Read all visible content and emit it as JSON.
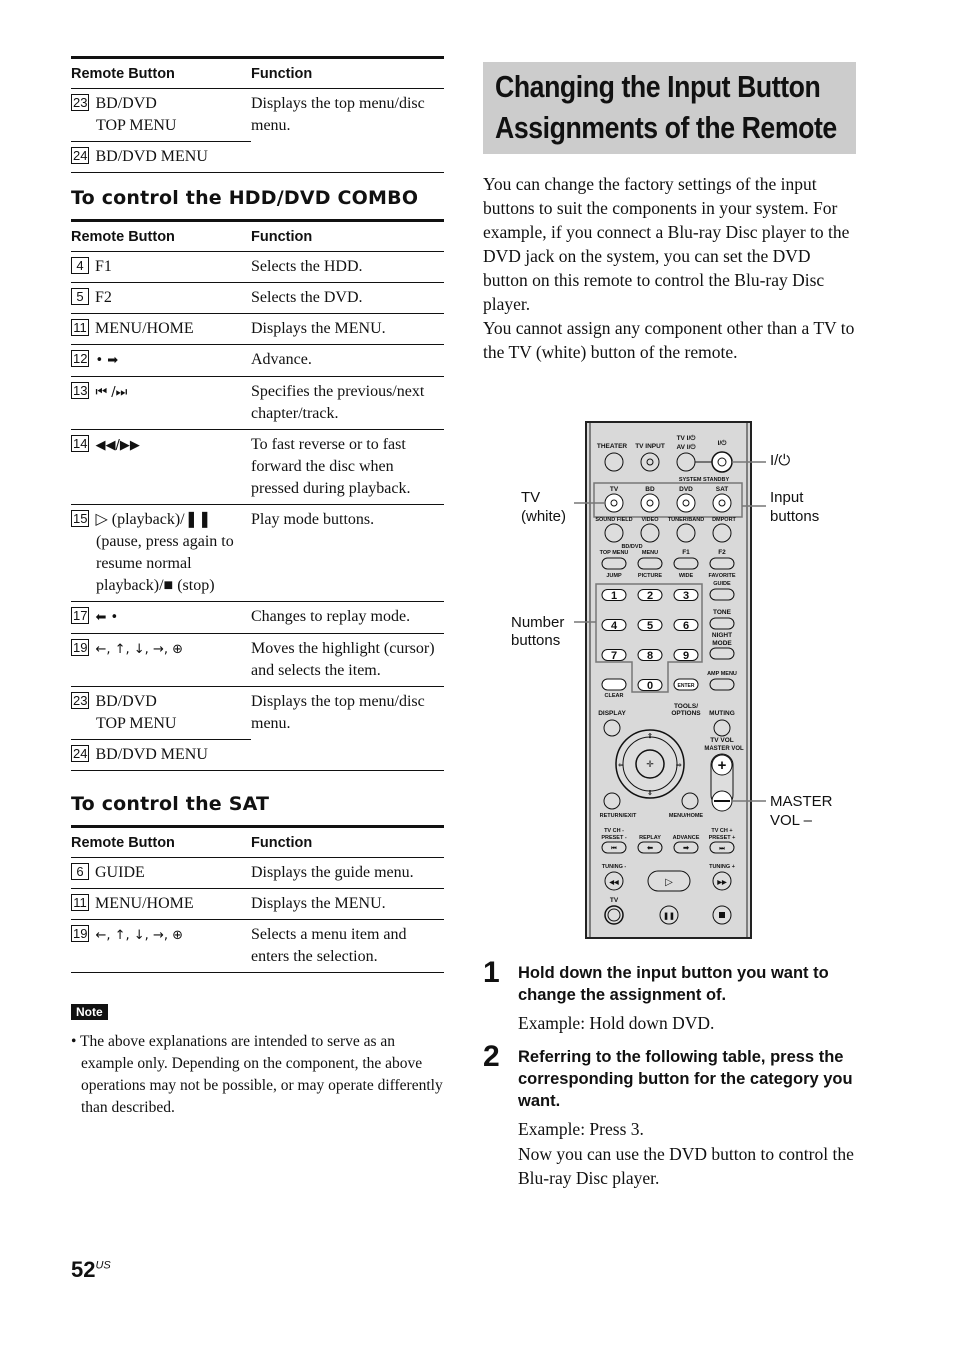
{
  "tables": {
    "continued": {
      "headers": [
        "Remote Button",
        "Function"
      ],
      "rows": [
        {
          "num": "23",
          "button": "BD/DVD",
          "button2": "TOP MENU",
          "function": "Displays the top menu/disc menu."
        },
        {
          "num": "24",
          "button": "BD/DVD MENU",
          "function": ""
        }
      ]
    },
    "hdd": {
      "heading": "To control the HDD/DVD COMBO",
      "headers": [
        "Remote Button",
        "Function"
      ],
      "rows": [
        {
          "num": "4",
          "button": "F1",
          "function": "Selects the HDD."
        },
        {
          "num": "5",
          "button": "F2",
          "function": "Selects the DVD."
        },
        {
          "num": "11",
          "button": "MENU/HOME",
          "function": "Displays the MENU."
        },
        {
          "num": "12",
          "button": "• ➡",
          "function": "Advance."
        },
        {
          "num": "13",
          "button": "⏮ /⏭",
          "function": "Specifies the previous/next chapter/track."
        },
        {
          "num": "14",
          "button": "◀◀/▶▶",
          "function": "To fast reverse or to fast forward the disc when pressed during playback."
        },
        {
          "num": "15",
          "button": "▷ (playback)/❚❚",
          "button2": "(pause, press again to resume normal playback)/■ (stop)",
          "function": "Play mode buttons."
        },
        {
          "num": "17",
          "button": "⬅ •",
          "function": "Changes to replay mode."
        },
        {
          "num": "19",
          "button": "←, ↑, ↓, →, ⊕",
          "function": "Moves the highlight (cursor) and selects the item."
        },
        {
          "num": "23",
          "button": "BD/DVD",
          "button2": "TOP MENU",
          "function": "Displays the top menu/disc menu."
        },
        {
          "num": "24",
          "button": "BD/DVD MENU",
          "function": ""
        }
      ]
    },
    "sat": {
      "heading": "To control the SAT",
      "headers": [
        "Remote Button",
        "Function"
      ],
      "rows": [
        {
          "num": "6",
          "button": "GUIDE",
          "function": "Displays the guide menu."
        },
        {
          "num": "11",
          "button": "MENU/HOME",
          "function": "Displays the MENU."
        },
        {
          "num": "19",
          "button": "←, ↑, ↓, →, ⊕",
          "function": "Selects a menu item and enters the selection."
        }
      ]
    }
  },
  "note": {
    "label": "Note",
    "text": "• The above explanations are intended to serve as an example only. Depending on the component, the above operations may not be possible, or may operate differently than described."
  },
  "section": {
    "title": "Changing the Input Button Assignments of the Remote",
    "intro1": "You can change the factory settings of the input buttons to suit the components in your system. For example, if you connect a Blu-ray Disc player to the DVD jack on the system, you can set the DVD button on this remote to control the Blu-ray Disc player.",
    "intro2": "You cannot assign any component other than a TV to the TV (white) button of the remote."
  },
  "diagram": {
    "callouts": {
      "power": "I/⏻",
      "input1": "Input",
      "input2": "buttons",
      "tv1": "TV",
      "tv2": "(white)",
      "num1": "Number",
      "num2": "buttons",
      "vol1": "MASTER",
      "vol2": "VOL –"
    },
    "remote": {
      "row1": [
        "THEATER",
        "TV INPUT",
        "TV I/⏻",
        "I/⏻"
      ],
      "av": "AV I/⏻",
      "standby": "SYSTEM STANDBY",
      "inputs": [
        "TV",
        "BD",
        "DVD",
        "SAT"
      ],
      "row3": [
        "SOUND FIELD",
        "VIDEO",
        "TUNER/BAND",
        "DMPORT"
      ],
      "bddvd": "BD/DVD",
      "row4top": [
        "TOP MENU",
        "MENU",
        "F1",
        "F2"
      ],
      "row4bot": [
        "JUMP",
        "PICTURE",
        "WIDE",
        "FAVORITE"
      ],
      "guide": "GUIDE",
      "digits": [
        "1",
        "2",
        "3",
        "4",
        "5",
        "6",
        "7",
        "8",
        "9",
        "0"
      ],
      "tone": "TONE",
      "night": "NIGHT",
      "mode": "MODE",
      "amp": "AMP MENU",
      "clear": "CLEAR",
      "enter": "ENTER",
      "display": "DISPLAY",
      "tools": "TOOLS/",
      "options": "OPTIONS",
      "muting": "MUTING",
      "tvvol": "TV VOL",
      "mastervol": "MASTER VOL",
      "return": "RETURN/EXIT",
      "menuhome": "MENU/HOME",
      "row7": [
        "TV CH -",
        "REPLAY",
        "ADVANCE",
        "TV CH +"
      ],
      "preset_minus": "PRESET -",
      "preset_plus": "PRESET +",
      "tuning_minus": "TUNING -",
      "tuning_plus": "TUNING +",
      "tv_bottom": "TV"
    }
  },
  "steps": [
    {
      "n": "1",
      "title": "Hold down the input button you want to change the assignment of.",
      "examples": [
        "Example: Hold down DVD."
      ]
    },
    {
      "n": "2",
      "title": "Referring to the following table, press the corresponding button for the category you want.",
      "examples": [
        "Example: Press 3.",
        "Now you can use the DVD button to control the Blu-ray Disc player."
      ]
    }
  ],
  "page": {
    "number": "52",
    "suffix": "US"
  }
}
